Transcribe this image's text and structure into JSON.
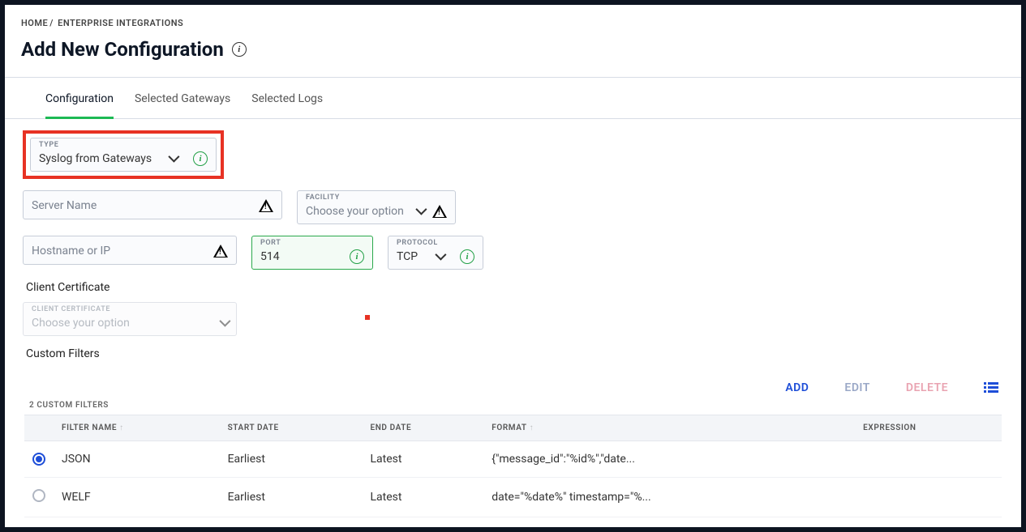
{
  "breadcrumb": {
    "home": "HOME",
    "sep": "/",
    "current": "ENTERPRISE INTEGRATIONS"
  },
  "page_title": "Add New Configuration",
  "tabs": [
    {
      "label": "Configuration",
      "active": true
    },
    {
      "label": "Selected Gateways",
      "active": false
    },
    {
      "label": "Selected Logs",
      "active": false
    }
  ],
  "form": {
    "type": {
      "label": "TYPE",
      "value": "Syslog from Gateways"
    },
    "server_name": {
      "placeholder": "Server Name"
    },
    "facility": {
      "label": "FACILITY",
      "placeholder": "Choose your option"
    },
    "hostname": {
      "placeholder": "Hostname or IP"
    },
    "port": {
      "label": "PORT",
      "value": "514"
    },
    "protocol": {
      "label": "PROTOCOL",
      "value": "TCP"
    },
    "client_cert_heading": "Client Certificate",
    "client_cert": {
      "label": "CLIENT CERTIFICATE",
      "placeholder": "Choose your option"
    },
    "custom_filters_heading": "Custom Filters"
  },
  "actions": {
    "add": "ADD",
    "edit": "EDIT",
    "delete": "DELETE"
  },
  "table": {
    "count_label": "2 CUSTOM FILTERS",
    "headers": {
      "filter_name": "FILTER NAME",
      "start_date": "START DATE",
      "end_date": "END DATE",
      "format": "FORMAT",
      "expression": "EXPRESSION"
    },
    "rows": [
      {
        "selected": true,
        "name": "JSON",
        "start": "Earliest",
        "end": "Latest",
        "format": "{\"message_id\":\"%id%\",\"date...",
        "expression": ""
      },
      {
        "selected": false,
        "name": "WELF",
        "start": "Earliest",
        "end": "Latest",
        "format": "date=\"%date%\" timestamp=\"%...",
        "expression": ""
      }
    ]
  }
}
